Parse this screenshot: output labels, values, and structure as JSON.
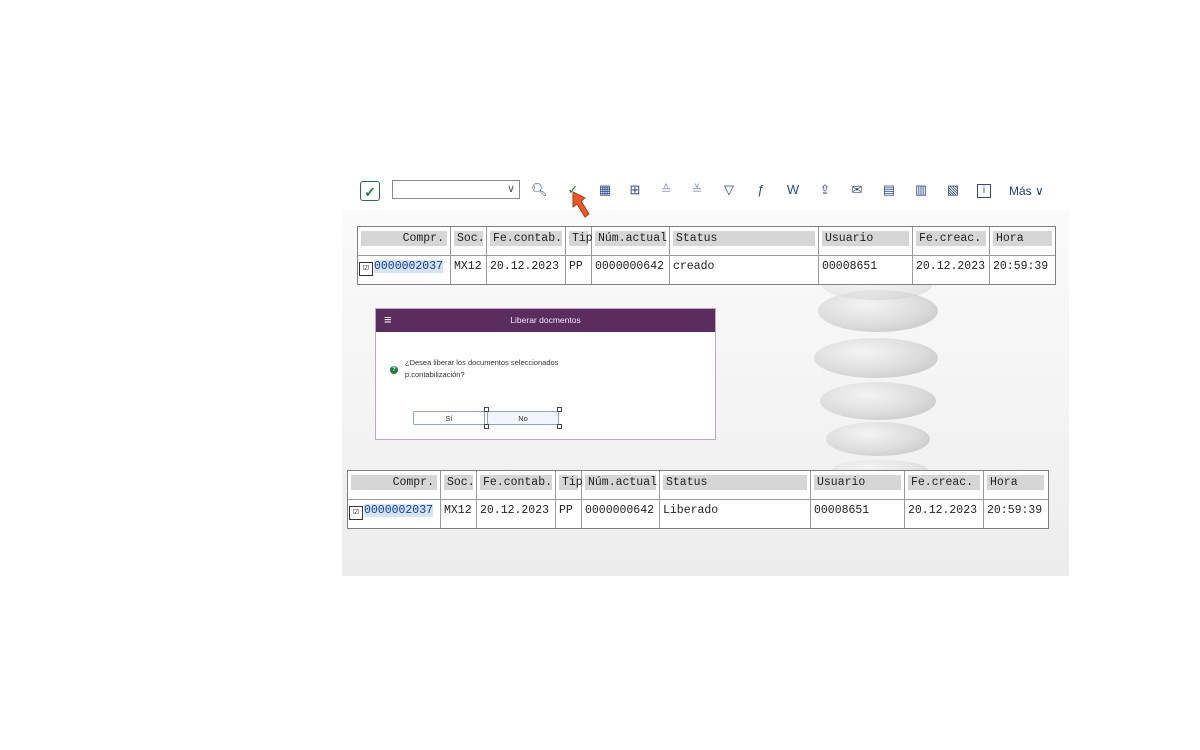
{
  "toolbar": {
    "confirm_icon": "green-checkmark-icon",
    "select_value": "",
    "more_label": "Más",
    "icons": [
      "document-search-icon",
      "release-icon",
      "layout-icon",
      "layout-change-icon",
      "sort-ascending-icon",
      "sort-descending-icon",
      "filter-icon",
      "formula-icon",
      "word-export-icon",
      "export-icon",
      "mail-icon",
      "spreadsheet-icon",
      "table-config-icon",
      "table-export-icon",
      "info-icon"
    ]
  },
  "table_top": {
    "headers": [
      "Compr.",
      "Soc.",
      "Fe.contab.",
      "Tip",
      "Núm.actual",
      "Status",
      "Usuario",
      "Fe.creac.",
      "Hora"
    ],
    "row": [
      "0000002037",
      "MX12",
      "20.12.2023",
      "PP",
      "0000000642",
      "creado",
      "00008651",
      "20.12.2023",
      "20:59:39"
    ],
    "checked": "☑"
  },
  "dialog": {
    "title": "Liberar docmentos",
    "question_line1": "¿Desea liberar los documentos seleccionados",
    "question_line2": "p.contabilización?",
    "yes_label": "Sí",
    "no_label": "No"
  },
  "table_bottom": {
    "headers": [
      "Compr.",
      "Soc.",
      "Fe.contab.",
      "Tip",
      "Núm.actual",
      "Status",
      "Usuario",
      "Fe.creac.",
      "Hora"
    ],
    "row": [
      "0000002037",
      "MX12",
      "20.12.2023",
      "PP",
      "0000000642",
      "Liberado",
      "00008651",
      "20.12.2023",
      "20:59:39"
    ],
    "checked": "☑"
  },
  "colors": {
    "dialog_header": "#5b2d5f",
    "accent_green": "#1f7d3a",
    "arrow": "#e8582a",
    "link_blue": "#1e3e8f"
  }
}
